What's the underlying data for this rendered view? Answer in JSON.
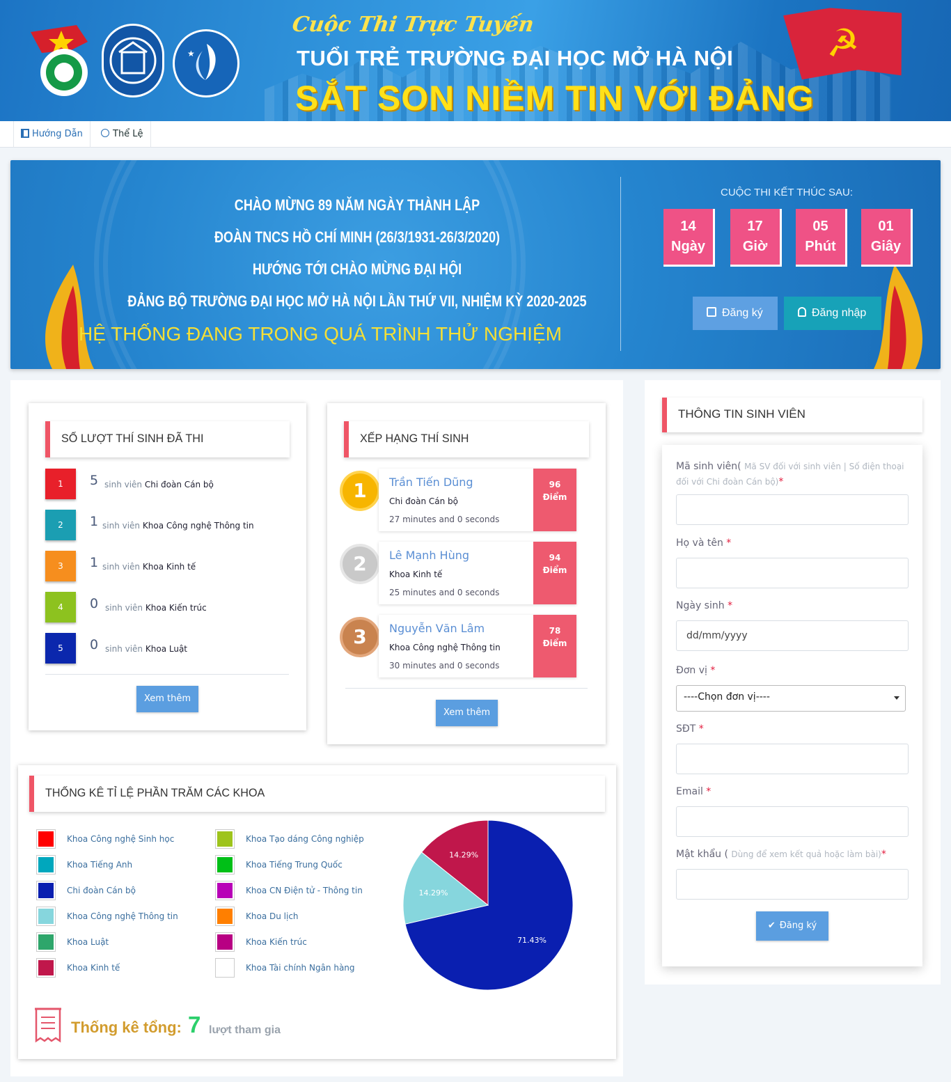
{
  "header": {
    "title_line1": "Cuộc Thi Trực Tuyến",
    "title_line2": "TUỔI TRẺ TRƯỜNG ĐẠI HỌC MỞ HÀ NỘI",
    "title_line3": "SẮT SON NIỀM TIN VỚI ĐẢNG",
    "logos": [
      "youth-union-logo",
      "hanoi-open-university-logo",
      "student-association-logo"
    ],
    "flag_icon": "party-flag-icon"
  },
  "nav": {
    "items": [
      {
        "label": "Hướng Dẫn",
        "icon": "book-icon"
      },
      {
        "label": "Thể Lệ",
        "icon": "clock-icon"
      }
    ]
  },
  "hero": {
    "lines": [
      "CHÀO MỪNG 89 NĂM NGÀY THÀNH LẬP",
      "ĐOÀN TNCS HỒ CHÍ MINH (26/3/1931-26/3/2020)",
      "HƯỚNG TỚI CHÀO MỪNG ĐẠI HỘI",
      "ĐẢNG BỘ TRƯỜNG ĐẠI HỌC MỞ HÀ NỘI LẦN THỨ VII, NHIỆM KỲ 2020-2025"
    ],
    "notice": "HỆ THỐNG ĐANG TRONG QUÁ TRÌNH THỬ NGHIỆM",
    "countdown_title": "CUỘC THI KẾT THÚC SAU:",
    "countdown": [
      {
        "value": "14",
        "unit": "Ngày"
      },
      {
        "value": "17",
        "unit": "Giờ"
      },
      {
        "value": "05",
        "unit": "Phút"
      },
      {
        "value": "01",
        "unit": "Giây"
      }
    ],
    "register_label": "Đăng ký",
    "login_label": "Đăng nhập"
  },
  "stats": {
    "title": "SỐ LƯỢT THÍ SINH ĐÃ THI",
    "unit_word": "sinh viên",
    "rows": [
      {
        "rank": "1",
        "count": "5",
        "unit": "Chi đoàn Cán bộ",
        "color": "#e8202a"
      },
      {
        "rank": "2",
        "count": "1",
        "unit": "Khoa Công nghệ Thông tin",
        "color": "#1b9eb2"
      },
      {
        "rank": "3",
        "count": "1",
        "unit": "Khoa Kinh tế",
        "color": "#f68e1e"
      },
      {
        "rank": "4",
        "count": "0",
        "unit": "Khoa Kiến trúc",
        "color": "#8dc21f"
      },
      {
        "rank": "5",
        "count": "0",
        "unit": "Khoa Luật",
        "color": "#0b27ad"
      }
    ],
    "more_label": "Xem thêm"
  },
  "ranking": {
    "title": "XẾP HẠNG THÍ SINH",
    "rows": [
      {
        "place": "1",
        "name": "Trần Tiến Dũng",
        "unit": "Chi đoàn Cán bộ",
        "time": "27 minutes and 0 seconds",
        "score": "96",
        "score_label": "Điểm",
        "color": "#f7b500"
      },
      {
        "place": "2",
        "name": "Lê Mạnh Hùng",
        "unit": "Khoa Kinh tế",
        "time": "25 minutes and 0 seconds",
        "score": "94",
        "score_label": "Điểm",
        "color": "#bfbfbf"
      },
      {
        "place": "3",
        "name": "Nguyễn Văn Lâm",
        "unit": "Khoa Công nghệ Thông tin",
        "time": "30 minutes and 0 seconds",
        "score": "78",
        "score_label": "Điểm",
        "color": "#c9834f"
      }
    ],
    "more_label": "Xem thêm"
  },
  "percent": {
    "title": "THỐNG KÊ TỈ LỆ PHẦN TRĂM CÁC KHOA",
    "legend_left": [
      {
        "label": "Khoa Công nghệ Sinh học",
        "color": "#ff0000"
      },
      {
        "label": "Khoa Tiếng Anh",
        "color": "#00a7bd"
      },
      {
        "label": "Chi đoàn Cán bộ",
        "color": "#0a1fb0"
      },
      {
        "label": "Khoa Công nghệ Thông tin",
        "color": "#86d6dd"
      },
      {
        "label": "Khoa Luật",
        "color": "#2ea66b"
      },
      {
        "label": "Khoa Kinh tế",
        "color": "#c0174b"
      }
    ],
    "legend_right": [
      {
        "label": "Khoa Tạo dáng Công nghiệp",
        "color": "#9ec41c"
      },
      {
        "label": "Khoa Tiếng Trung Quốc",
        "color": "#00bf17"
      },
      {
        "label": "Khoa CN Điện tử - Thông tin",
        "color": "#b800b7"
      },
      {
        "label": "Khoa Du lịch",
        "color": "#ff7f00"
      },
      {
        "label": "Khoa Kiến trúc",
        "color": "#b80083"
      },
      {
        "label": "Khoa Tài chính Ngân hàng",
        "color": "#ffffff"
      }
    ],
    "total_label": "Thống kê tổng:",
    "total_value": "7",
    "total_suffix": "lượt tham gia",
    "total_icon": "receipt-icon"
  },
  "chart_data": {
    "type": "pie",
    "categories": [
      "Chi đoàn Cán bộ",
      "Khoa Công nghệ Thông tin",
      "Khoa Kinh tế"
    ],
    "values": [
      71.43,
      14.29,
      14.29
    ],
    "labels": [
      "71.43%",
      "14.29%",
      "14.29%"
    ],
    "colors": [
      "#0a1fb0",
      "#86d6dd",
      "#c0174b"
    ]
  },
  "form": {
    "title": "THÔNG TIN SINH VIÊN",
    "student_id_label": "Mã sinh viên(",
    "student_id_hint": "Mã SV đối với sinh viên | Số điện thoại đối với Chi đoàn Cán bộ)",
    "name_label": "Họ và tên",
    "dob_label": "Ngày sinh",
    "dob_placeholder": "dd/mm/yyyy",
    "unit_label": "Đơn vị",
    "unit_selected": "----Chọn đơn vị----",
    "phone_label": "SĐT",
    "email_label": "Email",
    "password_label": "Mật khẩu (",
    "password_hint": "Dùng để xem kết quả hoặc làm bài)",
    "required_mark": "*",
    "submit_label": "Đăng ký"
  }
}
